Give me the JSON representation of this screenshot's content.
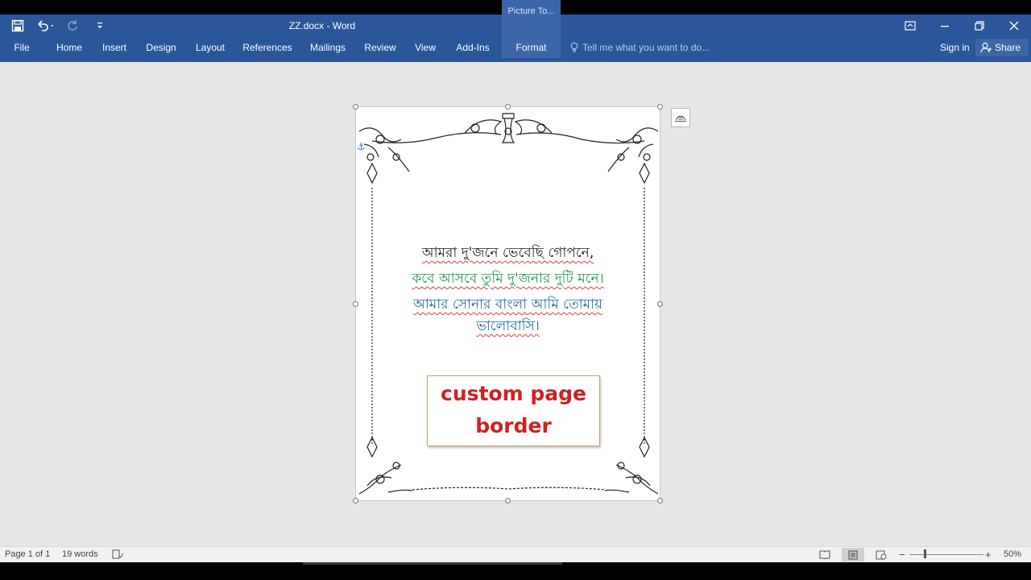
{
  "window": {
    "title": "ZZ.docx - Word",
    "contextual_tab_group": "Picture To..."
  },
  "ribbon": {
    "tabs": [
      "File",
      "Home",
      "Insert",
      "Design",
      "Layout",
      "References",
      "Mailings",
      "Review",
      "View",
      "Add-Ins",
      "Format"
    ],
    "active_tab": "Format",
    "tell_me_placeholder": "Tell me what you want to do...",
    "sign_in": "Sign in",
    "share": "Share"
  },
  "document": {
    "poem_lines": [
      "আমরা দু'জনে ভেবেছি গোপনে,",
      "কবে আসবে তুমি দু'জনার দুটি মনে।",
      "আমার সোনার বাংলা আমি তোমায়",
      "ভালোবাসি।"
    ],
    "textbox_lines": [
      "custom page",
      "border"
    ]
  },
  "status": {
    "page": "Page 1 of 1",
    "words": "19 words",
    "zoom": "50%"
  },
  "colors": {
    "accent": "#2b579a",
    "textbox_text": "#d21f1f",
    "line2": "#1f9a4a",
    "line3": "#1e6e9e"
  },
  "icons": [
    "save-icon",
    "undo-icon",
    "redo-icon",
    "customize-qat-icon",
    "ribbon-display-icon",
    "minimize-icon",
    "restore-icon",
    "close-icon",
    "lightbulb-icon",
    "share-person-icon",
    "anchor-icon",
    "layout-options-icon",
    "proofing-icon",
    "read-mode-icon",
    "print-layout-icon",
    "web-layout-icon"
  ]
}
